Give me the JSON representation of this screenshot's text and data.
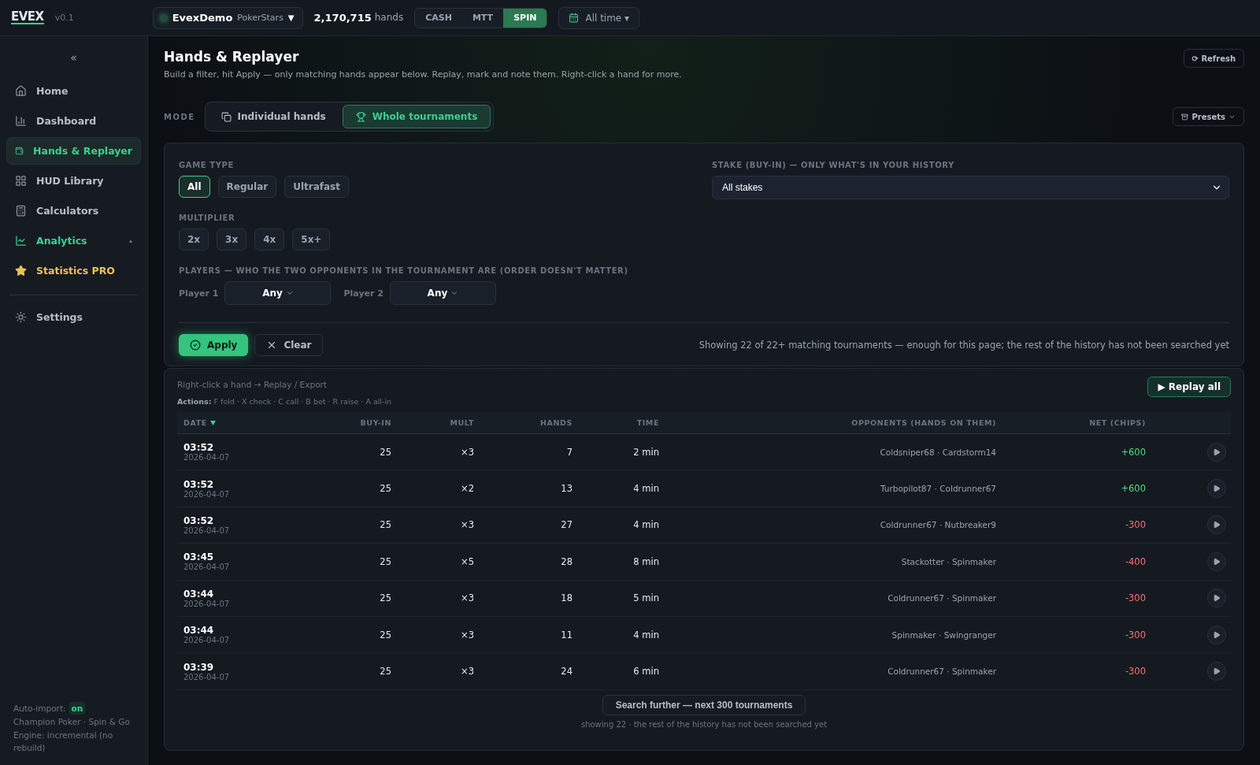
{
  "topbar": {
    "logo": "EVEX",
    "version": "v0.1",
    "account": {
      "name": "EvexDemo",
      "site": "PokerStars",
      "caret": "▼"
    },
    "hands_count": "2,170,715",
    "hands_label": "hands",
    "modes": [
      {
        "label": "CASH",
        "selected": false
      },
      {
        "label": "MTT",
        "selected": false
      },
      {
        "label": "SPIN",
        "selected": true
      }
    ],
    "period": "All time",
    "period_caret": "▾"
  },
  "sidebar": {
    "collapse": "«",
    "items": [
      {
        "label": "Home",
        "kind": "plain",
        "selected": false
      },
      {
        "label": "Dashboard",
        "kind": "plain",
        "selected": false
      },
      {
        "label": "Hands & Replayer",
        "kind": "plain",
        "selected": true
      },
      {
        "label": "HUD Library",
        "kind": "plain",
        "selected": false
      },
      {
        "label": "Calculators",
        "kind": "plain",
        "selected": false
      },
      {
        "label": "Analytics",
        "kind": "group",
        "selected": false,
        "expanded": false,
        "caret": "▴"
      },
      {
        "label": "Statistics PRO",
        "kind": "pro",
        "selected": false
      },
      {
        "label": "Settings",
        "kind": "plain",
        "selected": false
      }
    ],
    "footer": {
      "auto_import_label": "Auto-import:",
      "auto_import_state": "on",
      "source": "Champion Poker · Spin & Go",
      "engine": "Engine: incremental (no rebuild)"
    }
  },
  "page": {
    "title": "Hands & Replayer",
    "subtitle": "Build a filter, hit Apply — only matching hands appear below. Replay, mark and note them. Right-click a hand for more.",
    "refresh": "⟳ Refresh",
    "mode_label": "MODE",
    "modes": [
      {
        "label": "Individual hands",
        "selected": false
      },
      {
        "label": "Whole tournaments",
        "selected": true
      }
    ],
    "presets": "Presets"
  },
  "filters": {
    "game_type": {
      "label": "GAME TYPE",
      "options": [
        {
          "label": "All",
          "selected": true
        },
        {
          "label": "Regular",
          "selected": false
        },
        {
          "label": "Ultrafast",
          "selected": false
        }
      ]
    },
    "multiplier": {
      "label": "MULTIPLIER",
      "options": [
        {
          "label": "2x",
          "selected": false
        },
        {
          "label": "3x",
          "selected": false
        },
        {
          "label": "4x",
          "selected": false
        },
        {
          "label": "5x+",
          "selected": false
        }
      ]
    },
    "players": {
      "label": "PLAYERS — WHO THE TWO OPPONENTS IN THE TOURNAMENT ARE (ORDER DOESN'T MATTER)",
      "fields": [
        {
          "label": "Player 1",
          "value": "Any"
        },
        {
          "label": "Player 2",
          "value": "Any"
        }
      ]
    },
    "stake": {
      "label": "STAKE (BUY-IN) — ONLY WHAT'S IN YOUR HISTORY",
      "value": "All stakes"
    },
    "apply": "Apply",
    "clear": "Clear",
    "status": "Showing 22 of 22+ matching tournaments — enough for this page; the rest of the history has not been searched yet"
  },
  "results": {
    "hint": "Right-click a hand → Replay / Export",
    "legend": "**Actions:** F fold · X check · C call · B bet · R raise · A all-in",
    "replay_all": "▶ Replay all",
    "columns": [
      {
        "label": "DATE",
        "sorted": true
      },
      {
        "label": "BUY-IN",
        "sorted": false
      },
      {
        "label": "MULT",
        "sorted": false
      },
      {
        "label": "HANDS",
        "sorted": false
      },
      {
        "label": "TIME",
        "sorted": false
      },
      {
        "label": "OPPONENTS (HANDS ON THEM)",
        "sorted": false
      },
      {
        "label": "NET (CHIPS)",
        "sorted": false
      }
    ],
    "rows": [
      {
        "time": "03:52",
        "date": "2026-04-07",
        "buy_in": "25",
        "mult": "×3",
        "hands": "7",
        "duration": "2 min",
        "opponents": "Coldsniper68 · Cardstorm14",
        "net": "+600",
        "color": "#4ade80"
      },
      {
        "time": "03:52",
        "date": "2026-04-07",
        "buy_in": "25",
        "mult": "×2",
        "hands": "13",
        "duration": "4 min",
        "opponents": "Turbopilot87 · Coldrunner67",
        "net": "+600",
        "color": "#4ade80"
      },
      {
        "time": "03:52",
        "date": "2026-04-07",
        "buy_in": "25",
        "mult": "×3",
        "hands": "27",
        "duration": "4 min",
        "opponents": "Coldrunner67 · Nutbreaker9",
        "net": "-300",
        "color": "#f87171"
      },
      {
        "time": "03:45",
        "date": "2026-04-07",
        "buy_in": "25",
        "mult": "×5",
        "hands": "28",
        "duration": "8 min",
        "opponents": "Stackotter · Spinmaker",
        "net": "-400",
        "color": "#f87171"
      },
      {
        "time": "03:44",
        "date": "2026-04-07",
        "buy_in": "25",
        "mult": "×3",
        "hands": "18",
        "duration": "5 min",
        "opponents": "Coldrunner67 · Spinmaker",
        "net": "-300",
        "color": "#f87171"
      },
      {
        "time": "03:44",
        "date": "2026-04-07",
        "buy_in": "25",
        "mult": "×3",
        "hands": "11",
        "duration": "4 min",
        "opponents": "Spinmaker · Swingranger",
        "net": "-300",
        "color": "#f87171"
      },
      {
        "time": "03:39",
        "date": "2026-04-07",
        "buy_in": "25",
        "mult": "×3",
        "hands": "24",
        "duration": "6 min",
        "opponents": "Coldrunner67 · Spinmaker",
        "net": "-300",
        "color": "#f87171"
      }
    ],
    "search_more": "Search further — next 300 tournaments",
    "search_note": "showing 22 · the rest of the history has not been searched yet"
  }
}
